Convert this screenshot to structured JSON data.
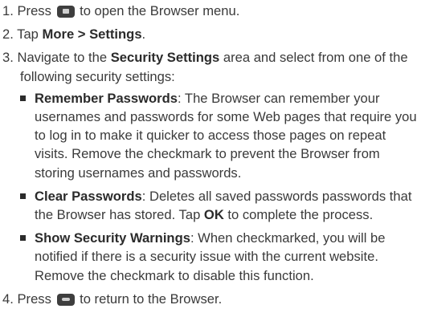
{
  "steps": [
    {
      "num": "1.",
      "before": "Press ",
      "icon": "menu-key-icon",
      "after": " to open the Browser menu."
    },
    {
      "num": "2.",
      "before": "Tap ",
      "bold": "More > Settings",
      "after": "."
    },
    {
      "num": "3.",
      "before": "Navigate to the ",
      "bold": "Security Settings",
      "after": " area and select from one of the following security settings:"
    },
    {
      "num": "4.",
      "before": "Press ",
      "icon": "back-key-icon",
      "after": " to return to the Browser."
    }
  ],
  "settings": [
    {
      "title": "Remember Passwords",
      "text": ": The Browser can remember your usernames and passwords for some Web pages that require you to log in to make it quicker to access those pages on repeat visits. Remove the checkmark to prevent the Browser from storing usernames and passwords."
    },
    {
      "title": "Clear Passwords",
      "text_before": ": Deletes all saved passwords passwords that the Browser has stored. Tap ",
      "bold_mid": "OK",
      "text_after": " to complete the process."
    },
    {
      "title": "Show Security Warnings",
      "text": ": When checkmarked, you will be notified if there is a security issue with the current website. Remove the checkmark to disable this function."
    }
  ]
}
